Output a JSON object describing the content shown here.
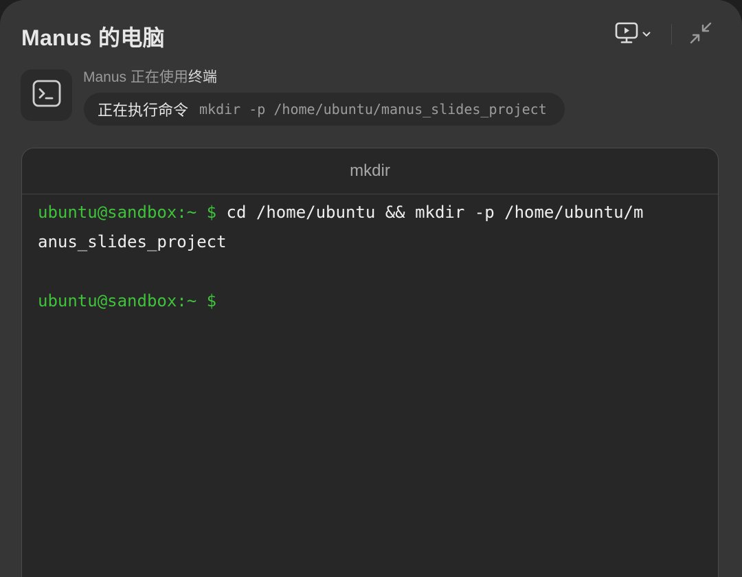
{
  "window": {
    "title": "Manus 的电脑",
    "icons": {
      "screen": "monitor-play-icon",
      "dropdown": "chevron-down-icon",
      "shrink": "shrink-icon"
    }
  },
  "status": {
    "icon": "terminal-icon",
    "prefix": "Manus 正在使用",
    "tool": "终端",
    "command_label": "正在执行命令",
    "command": "mkdir -p /home/ubuntu/manus_slides_project"
  },
  "terminal": {
    "title": "mkdir",
    "prompt": "ubuntu@sandbox:~",
    "dollar": "$",
    "lines": [
      {
        "command_part1": "cd /home/ubuntu && mkdir -p /home/ubuntu/m",
        "command_part2": "anus_slides_project"
      }
    ]
  },
  "colors": {
    "panel_bg": "#363637",
    "terminal_bg": "#272727",
    "prompt_green": "#3ec33a",
    "text_light": "#e8e8e8"
  }
}
